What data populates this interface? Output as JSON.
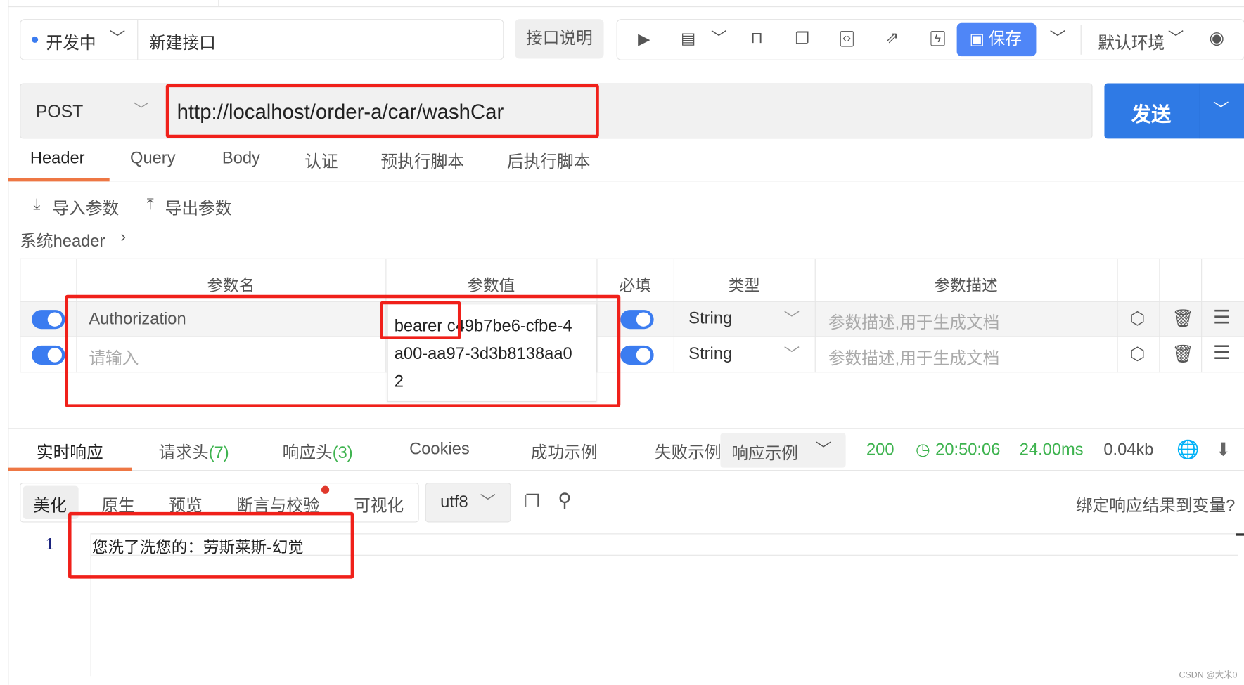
{
  "top_bar": {
    "status": "开发中",
    "status_color": "#3b7cf0",
    "name": "新建接口",
    "doc_button": "接口说明",
    "save_button": "保存",
    "environment": "默认环境",
    "accent_color": "#4f86f7"
  },
  "request": {
    "method": "POST",
    "url": "http://localhost/order-a/car/washCar",
    "send_button": "发送"
  },
  "tabs": [
    "Header",
    "Query",
    "Body",
    "认证",
    "预执行脚本",
    "后执行脚本"
  ],
  "header_tools": {
    "import": "导入参数",
    "export": "导出参数",
    "system_header": "系统header"
  },
  "table": {
    "columns": [
      "参数名",
      "参数值",
      "必填",
      "类型",
      "参数描述"
    ],
    "rows": [
      {
        "enabled": true,
        "name": "Authorization",
        "value_lines": [
          "bearer c49b7be6-cfbe-4",
          "a00-aa97-3d3b8138aa0",
          "2"
        ],
        "required": true,
        "type": "String",
        "desc_placeholder": "参数描述,用于生成文档"
      },
      {
        "enabled": true,
        "name_placeholder": "请输入",
        "required": true,
        "type": "String",
        "desc_placeholder": "参数描述,用于生成文档"
      }
    ]
  },
  "response": {
    "tabs": {
      "live": "实时响应",
      "req_headers": "请求头",
      "req_count": "(7)",
      "resp_headers": "响应头",
      "resp_count": "(3)",
      "cookies": "Cookies",
      "success": "成功示例",
      "fail": "失败示例",
      "example": "响应示例"
    },
    "status": "200",
    "time": "20:50:06",
    "duration": "24.00ms",
    "size": "0.04kb",
    "view_tabs": [
      "美化",
      "原生",
      "预览",
      "断言与校验",
      "可视化"
    ],
    "encoding": "utf8",
    "bind_link": "绑定响应结果到变量?",
    "line_number": "1",
    "body": "您洗了洗您的：劳斯莱斯-幻觉"
  },
  "watermark": "CSDN @大米0"
}
